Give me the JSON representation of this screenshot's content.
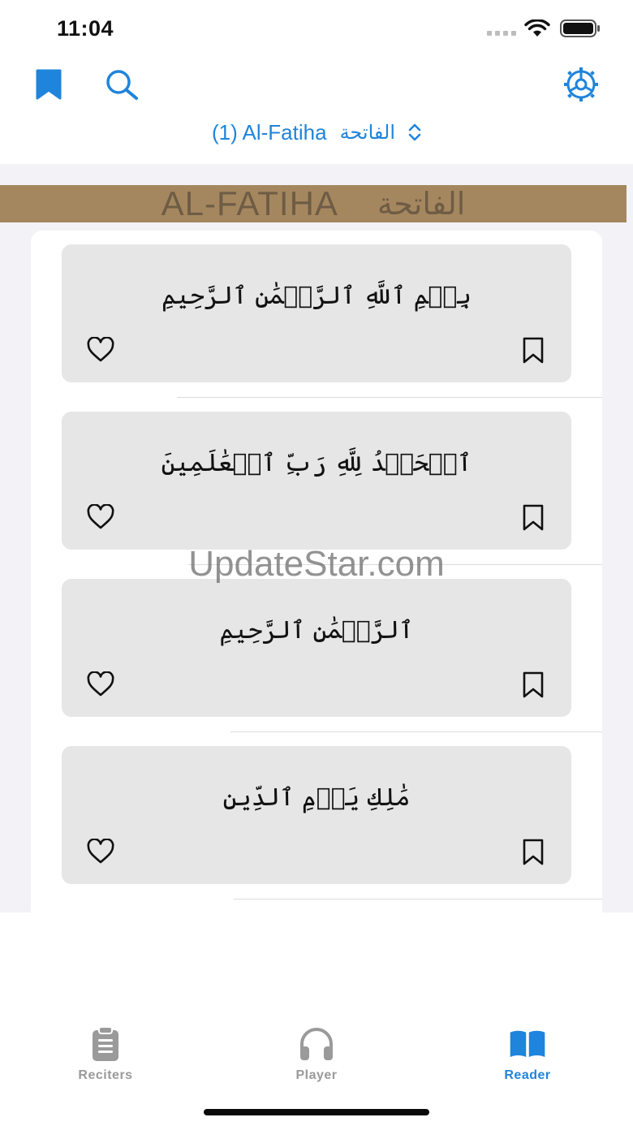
{
  "status_bar": {
    "time": "11:04"
  },
  "nav": {
    "surah_title": "(1) Al-Fatiha",
    "surah_title_ar": "الفاتحة",
    "accent_color": "#1f84db"
  },
  "header": {
    "title_en": "AL-FATIHA",
    "title_ar": "الفاتحة",
    "banner_color": "#a5875f"
  },
  "verses": [
    {
      "text": "بِسۡمِ ٱللَّهِ ٱلرَّحۡمَٰنِ ٱلرَّحِيمِ"
    },
    {
      "text": "ٱلۡحَمۡدُ لِلَّهِ رَبِّ ٱلۡعَٰلَمِينَ"
    },
    {
      "text": "ٱلرَّحۡمَٰنِ ٱلرَّحِيمِ"
    },
    {
      "text": "مَٰلِكِ يَوۡمِ ٱلدِّينِ"
    }
  ],
  "watermark": "UpdateStar.com",
  "tabs": [
    {
      "label": "Reciters",
      "icon": "clipboard-icon",
      "active": false
    },
    {
      "label": "Player",
      "icon": "headphones-icon",
      "active": false
    },
    {
      "label": "Reader",
      "icon": "book-icon",
      "active": true
    }
  ]
}
